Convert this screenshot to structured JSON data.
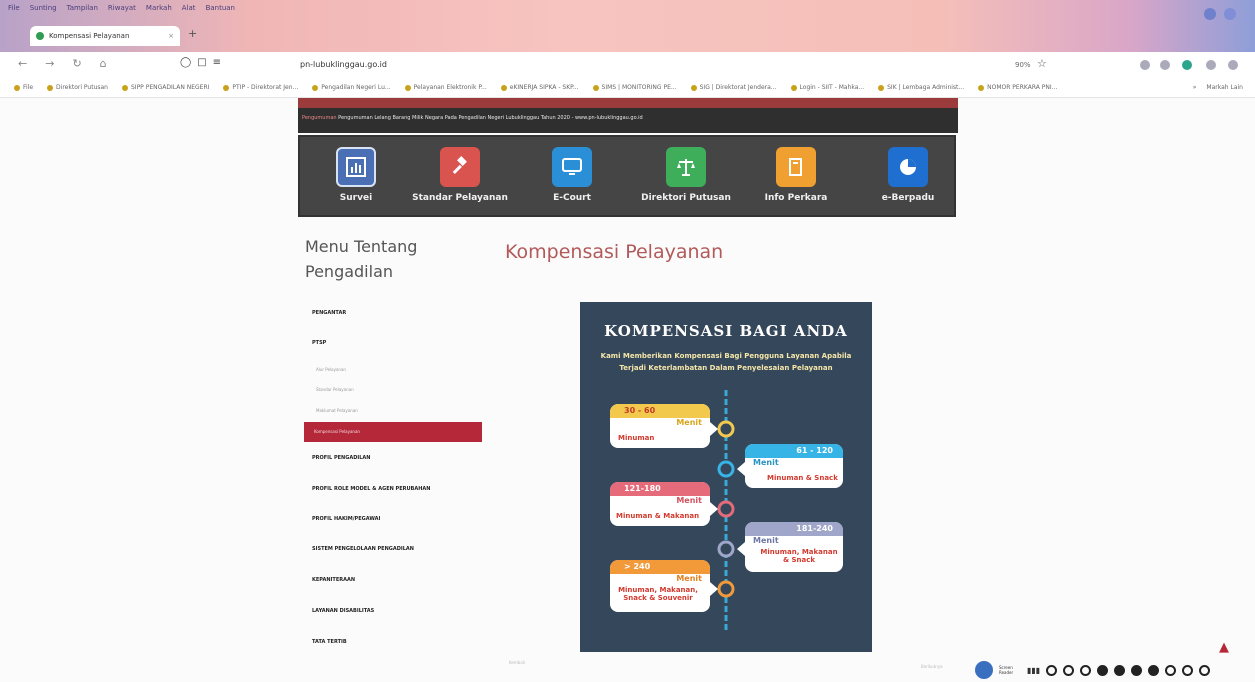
{
  "browser": {
    "menu": [
      "File",
      "Sunting",
      "Tampilan",
      "Riwayat",
      "Markah",
      "Alat",
      "Bantuan"
    ],
    "tab_title": "Kompensasi Pelayanan",
    "tab_close": "×",
    "new_tab": "+",
    "url": "pn-lubuklinggau.go.id",
    "zoom": "90%",
    "bookmarks": [
      "File",
      "Direktori Putusan",
      "SIPP PENGADILAN NEGERI",
      "PTIP - Direktorat Jen...",
      "Pengadilan Negeri Lu...",
      "Pelayanan Elektronik P...",
      "eKINERJA SIPKA - SKP...",
      "SIMS | MONITORING PE...",
      "SIG | Direktorat Jendera...",
      "Login - SIIT - Mahka...",
      "SIK | Lembaga Administ...",
      "NOMOR PERKARA PNI..."
    ],
    "bookmark_more": "»",
    "other_bookmarks": "Markah Lain"
  },
  "site": {
    "running_text_label": "Pengumuman",
    "running_text": "Pengumuman Lelang Barang Milik Negara Pada Pengadilan Negeri Lubuklinggau Tahun 2020 - www.pn-lubuklinggau.go.id",
    "menu": [
      {
        "label": "Survei",
        "color": "#4a6fb5"
      },
      {
        "label": "Standar Pelayanan",
        "color": "#d9534f"
      },
      {
        "label": "E-Court",
        "color": "#2a8fd6"
      },
      {
        "label": "Direktori Putusan",
        "color": "#3fae5a"
      },
      {
        "label": "Info Perkara",
        "color": "#f0a030"
      },
      {
        "label": "e-Berpadu",
        "color": "#1f6fd0"
      }
    ]
  },
  "sidebar": {
    "title": "Menu Tentang Pengadilan",
    "items": [
      "PENGANTAR",
      "PTSP",
      "PROFIL PENGADILAN",
      "PROFIL ROLE MODEL & AGEN PERUBAHAN",
      "PROFIL HAKIM/PEGAWAI",
      "SISTEM PENGELOLAAN PENGADILAN",
      "KEPANITERAAN",
      "LAYANAN DISABILITAS",
      "TATA TERTIB"
    ],
    "sub_items": [
      "Alur Pelayanan",
      "Standar Pelayanan",
      "Maklumat Pelayanan"
    ],
    "active": "Kompensasi Pelayanan"
  },
  "main": {
    "title": "Kompensasi Pelayanan",
    "back": "Kembali",
    "next": "Berikutnya"
  },
  "poster": {
    "title": "KOMPENSASI BAGI ANDA",
    "subtitle_line1": "Kami Memberikan Kompensasi Bagi Pengguna Layanan Apabila",
    "subtitle_line2": "Terjadi Keterlambatan Dalam Penyelesaian Pelayanan",
    "unit": "Menit",
    "tiers": [
      {
        "range": "30 - 60",
        "reward": "Minuman",
        "color": "#f2c94c"
      },
      {
        "range": "61 - 120",
        "reward": "Minuman & Snack",
        "color": "#37b4e6"
      },
      {
        "range": "121-180",
        "reward": "Minuman & Makanan",
        "color": "#e56b7a"
      },
      {
        "range": "181-240",
        "reward": "Minuman, Makanan & Snack",
        "color": "#9fa6c9"
      },
      {
        "range": "> 240",
        "reward": "Minuman, Makanan, Snack & Souvenir",
        "color": "#f29a3a"
      }
    ]
  },
  "accessibility": {
    "reader_label": "Screen Reader",
    "bars": "▮▮▮"
  }
}
